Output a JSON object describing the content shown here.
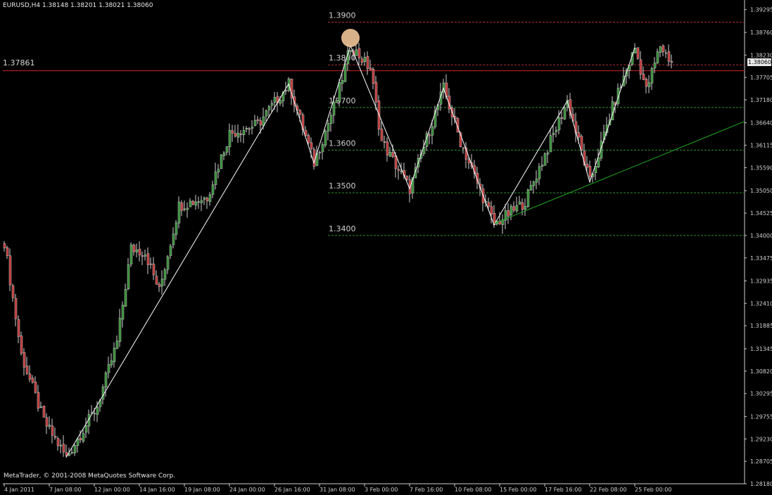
{
  "window": {
    "symbol_header": "EURUSD,H4  1.38148 1.38201 1.38021 1.38060",
    "copyright": "MetaTrader, © 2001-2008 MetaQuotes Software Corp."
  },
  "horizontal_line": {
    "label": "1.37861",
    "price": 1.37861,
    "color": "#cc2222"
  },
  "current_price": {
    "label": "1.38060",
    "price": 1.3806
  },
  "colors": {
    "background": "#000000",
    "bull_candle": "#2e8b2e",
    "bear_candle": "#c03030",
    "wick": "#cfcfcf",
    "zigzag": "#ffffff",
    "trendline": "#22aa22",
    "fib_green": "#2f8f2f",
    "fib_red": "#b03030",
    "marker": "#ffd0a0"
  },
  "fib_levels": [
    {
      "label": "1.3900",
      "price": 1.39,
      "color": "red"
    },
    {
      "label": "1.3800",
      "price": 1.38,
      "color": "red"
    },
    {
      "label": "1.3700",
      "price": 1.37,
      "color": "green"
    },
    {
      "label": "1.3600",
      "price": 1.36,
      "color": "green"
    },
    {
      "label": "1.3500",
      "price": 1.35,
      "color": "green"
    },
    {
      "label": "1.3400",
      "price": 1.34,
      "color": "green"
    }
  ],
  "chart_data": {
    "type": "candlestick",
    "symbol": "EURUSD",
    "timeframe": "H4",
    "ylim": [
      1.2818,
      1.3952
    ],
    "y_ticks": [
      "1.39295",
      "1.38760",
      "1.38230",
      "1.37705",
      "1.37180",
      "1.36640",
      "1.36115",
      "1.35590",
      "1.35050",
      "1.34525",
      "1.34000",
      "1.33475",
      "1.32935",
      "1.32410",
      "1.31885",
      "1.31345",
      "1.30820",
      "1.30295",
      "1.29755",
      "1.29230",
      "1.28705",
      "1.28180"
    ],
    "y_tick_values": [
      1.39295,
      1.3876,
      1.3823,
      1.37705,
      1.3718,
      1.3664,
      1.36115,
      1.3559,
      1.3505,
      1.34525,
      1.34,
      1.33475,
      1.32935,
      1.3241,
      1.31885,
      1.31345,
      1.3082,
      1.30295,
      1.29755,
      1.2923,
      1.28705,
      1.2818
    ],
    "x_ticks": [
      "4 Jan 2011",
      "7 Jan 08:00",
      "12 Jan 00:00",
      "14 Jan 16:00",
      "19 Jan 08:00",
      "24 Jan 00:00",
      "26 Jan 16:00",
      "31 Jan 08:00",
      "3 Feb 00:00",
      "7 Feb 16:00",
      "10 Feb 08:00",
      "15 Feb 00:00",
      "17 Feb 16:00",
      "22 Feb 08:00",
      "25 Feb 00:00"
    ],
    "x_tick_bars": [
      0,
      16,
      32,
      48,
      64,
      80,
      96,
      112,
      128,
      144,
      160,
      176,
      192,
      208,
      224
    ],
    "bar_count": 238,
    "swing_points": [
      {
        "bar": 0,
        "price": 1.3385
      },
      {
        "bar": 6,
        "price": 1.312
      },
      {
        "bar": 14,
        "price": 1.2965
      },
      {
        "bar": 22,
        "price": 1.288
      },
      {
        "bar": 33,
        "price": 1.3
      },
      {
        "bar": 40,
        "price": 1.315
      },
      {
        "bar": 45,
        "price": 1.337
      },
      {
        "bar": 50,
        "price": 1.336
      },
      {
        "bar": 55,
        "price": 1.327
      },
      {
        "bar": 62,
        "price": 1.347
      },
      {
        "bar": 72,
        "price": 1.349
      },
      {
        "bar": 80,
        "price": 1.364
      },
      {
        "bar": 90,
        "price": 1.366
      },
      {
        "bar": 101,
        "price": 1.3755
      },
      {
        "bar": 110,
        "price": 1.357
      },
      {
        "bar": 118,
        "price": 1.372
      },
      {
        "bar": 123,
        "price": 1.3845
      },
      {
        "bar": 130,
        "price": 1.379
      },
      {
        "bar": 134,
        "price": 1.362
      },
      {
        "bar": 144,
        "price": 1.351
      },
      {
        "bar": 156,
        "price": 1.3745
      },
      {
        "bar": 162,
        "price": 1.362
      },
      {
        "bar": 174,
        "price": 1.3425
      },
      {
        "bar": 185,
        "price": 1.348
      },
      {
        "bar": 200,
        "price": 1.3715
      },
      {
        "bar": 208,
        "price": 1.3525
      },
      {
        "bar": 216,
        "price": 1.37
      },
      {
        "bar": 224,
        "price": 1.384
      },
      {
        "bar": 228,
        "price": 1.374
      },
      {
        "bar": 233,
        "price": 1.3845
      },
      {
        "bar": 237,
        "price": 1.3806
      }
    ],
    "zigzag": [
      {
        "bar": 22,
        "price": 1.288
      },
      {
        "bar": 101,
        "price": 1.3755
      },
      {
        "bar": 110,
        "price": 1.357
      },
      {
        "bar": 123,
        "price": 1.3845
      },
      {
        "bar": 144,
        "price": 1.351
      },
      {
        "bar": 156,
        "price": 1.3745
      },
      {
        "bar": 174,
        "price": 1.3425
      },
      {
        "bar": 200,
        "price": 1.3715
      },
      {
        "bar": 208,
        "price": 1.3525
      },
      {
        "bar": 224,
        "price": 1.384
      }
    ],
    "trendline": [
      {
        "bar": 174,
        "price": 1.3428
      },
      {
        "bar": 264,
        "price": 1.367
      }
    ],
    "top_marker": {
      "bar": 123,
      "price": 1.3863
    }
  }
}
